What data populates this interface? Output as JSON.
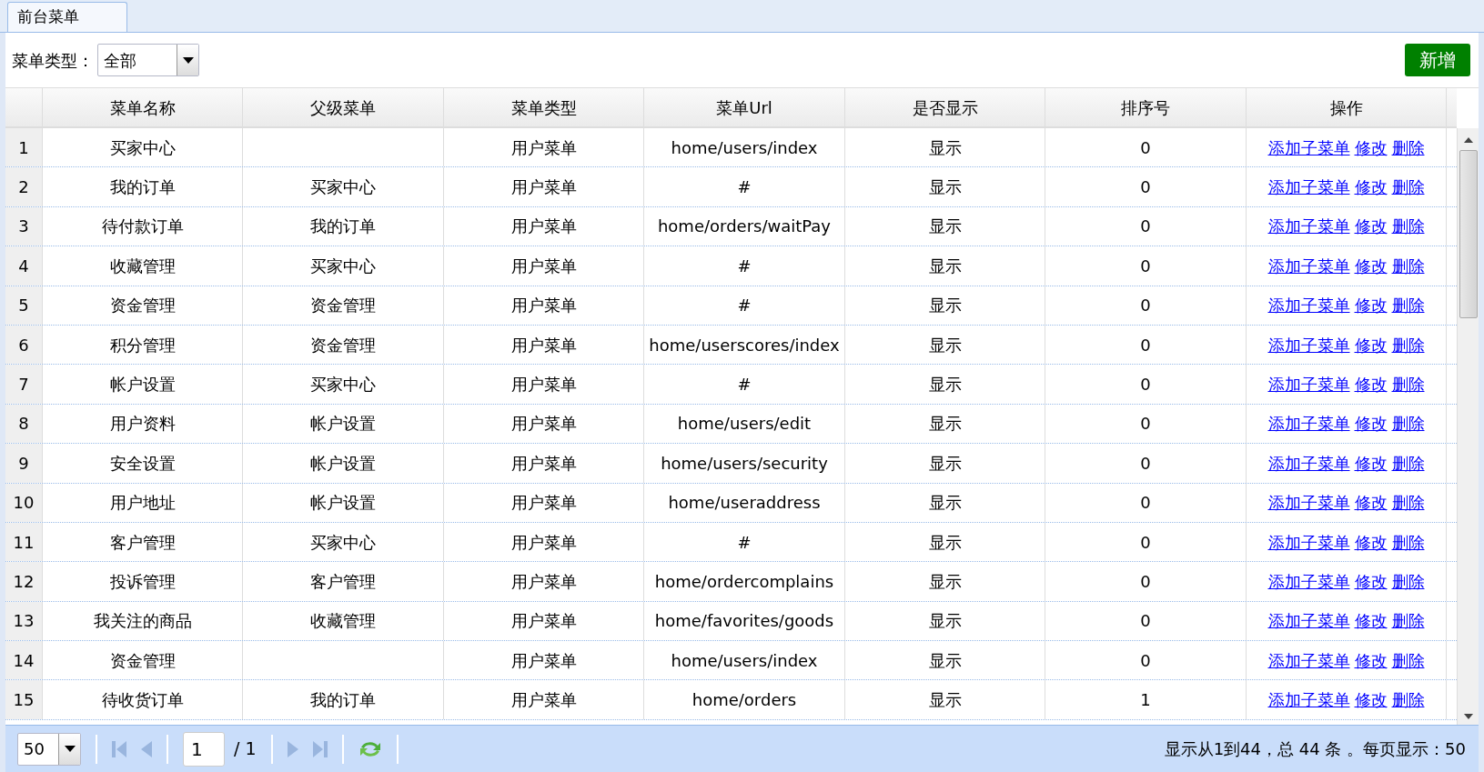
{
  "tabs": [
    {
      "label": "前台菜单",
      "selected": true
    }
  ],
  "filter": {
    "label": "菜单类型：",
    "value": "全部"
  },
  "add_button": "新增",
  "table": {
    "columns": [
      "菜单名称",
      "父级菜单",
      "菜单类型",
      "菜单Url",
      "是否显示",
      "排序号",
      "操作"
    ],
    "rows": [
      {
        "no": "1",
        "name": "买家中心",
        "parent": "",
        "type": "用户菜单",
        "url": "home/users/index",
        "show": "显示",
        "order": "0",
        "actions": [
          "添加子菜单",
          "修改",
          "删除"
        ]
      },
      {
        "no": "2",
        "name": "我的订单",
        "parent": "买家中心",
        "type": "用户菜单",
        "url": "#",
        "show": "显示",
        "order": "0",
        "actions": [
          "添加子菜单",
          "修改",
          "删除"
        ]
      },
      {
        "no": "3",
        "name": "待付款订单",
        "parent": "我的订单",
        "type": "用户菜单",
        "url": "home/orders/waitPay",
        "show": "显示",
        "order": "0",
        "actions": [
          "添加子菜单",
          "修改",
          "删除"
        ]
      },
      {
        "no": "4",
        "name": "收藏管理",
        "parent": "买家中心",
        "type": "用户菜单",
        "url": "#",
        "show": "显示",
        "order": "0",
        "actions": [
          "添加子菜单",
          "修改",
          "删除"
        ]
      },
      {
        "no": "5",
        "name": "资金管理",
        "parent": "资金管理",
        "type": "用户菜单",
        "url": "#",
        "show": "显示",
        "order": "0",
        "actions": [
          "添加子菜单",
          "修改",
          "删除"
        ]
      },
      {
        "no": "6",
        "name": "积分管理",
        "parent": "资金管理",
        "type": "用户菜单",
        "url": "home/userscores/index",
        "show": "显示",
        "order": "0",
        "actions": [
          "添加子菜单",
          "修改",
          "删除"
        ]
      },
      {
        "no": "7",
        "name": "帐户设置",
        "parent": "买家中心",
        "type": "用户菜单",
        "url": "#",
        "show": "显示",
        "order": "0",
        "actions": [
          "添加子菜单",
          "修改",
          "删除"
        ]
      },
      {
        "no": "8",
        "name": "用户资料",
        "parent": "帐户设置",
        "type": "用户菜单",
        "url": "home/users/edit",
        "show": "显示",
        "order": "0",
        "actions": [
          "添加子菜单",
          "修改",
          "删除"
        ]
      },
      {
        "no": "9",
        "name": "安全设置",
        "parent": "帐户设置",
        "type": "用户菜单",
        "url": "home/users/security",
        "show": "显示",
        "order": "0",
        "actions": [
          "添加子菜单",
          "修改",
          "删除"
        ]
      },
      {
        "no": "10",
        "name": "用户地址",
        "parent": "帐户设置",
        "type": "用户菜单",
        "url": "home/useraddress",
        "show": "显示",
        "order": "0",
        "actions": [
          "添加子菜单",
          "修改",
          "删除"
        ]
      },
      {
        "no": "11",
        "name": "客户管理",
        "parent": "买家中心",
        "type": "用户菜单",
        "url": "#",
        "show": "显示",
        "order": "0",
        "actions": [
          "添加子菜单",
          "修改",
          "删除"
        ]
      },
      {
        "no": "12",
        "name": "投诉管理",
        "parent": "客户管理",
        "type": "用户菜单",
        "url": "home/ordercomplains",
        "show": "显示",
        "order": "0",
        "actions": [
          "添加子菜单",
          "修改",
          "删除"
        ]
      },
      {
        "no": "13",
        "name": "我关注的商品",
        "parent": "收藏管理",
        "type": "用户菜单",
        "url": "home/favorites/goods",
        "show": "显示",
        "order": "0",
        "actions": [
          "添加子菜单",
          "修改",
          "删除"
        ]
      },
      {
        "no": "14",
        "name": "资金管理",
        "parent": "",
        "type": "用户菜单",
        "url": "home/users/index",
        "show": "显示",
        "order": "0",
        "actions": [
          "添加子菜单",
          "修改",
          "删除"
        ]
      },
      {
        "no": "15",
        "name": "待收货订单",
        "parent": "我的订单",
        "type": "用户菜单",
        "url": "home/orders",
        "show": "显示",
        "order": "1",
        "actions": [
          "添加子菜单",
          "修改",
          "删除"
        ]
      }
    ]
  },
  "pager": {
    "page_size": "50",
    "page": "1",
    "pages": "/ 1",
    "summary": "显示从1到44，总 44 条 。每页显示：50"
  }
}
